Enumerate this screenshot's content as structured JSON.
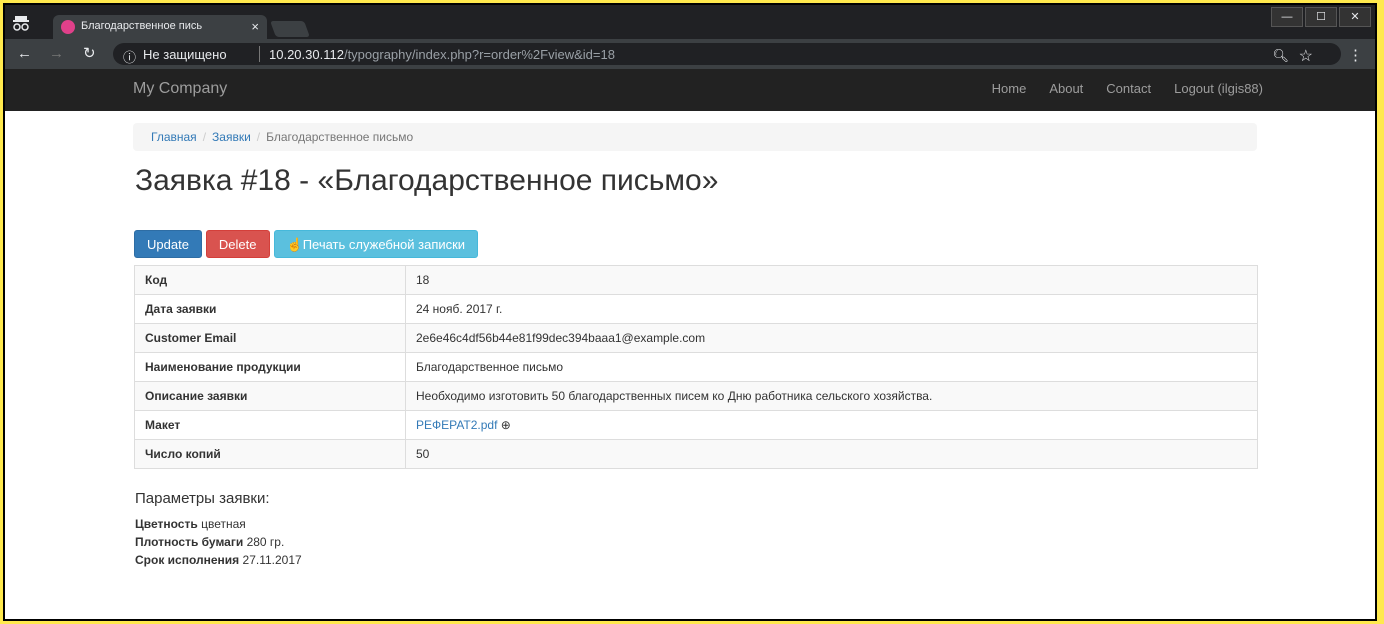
{
  "browser": {
    "tab": {
      "title": "Благодарственное пись"
    },
    "address": {
      "status": "Не защищено",
      "url_host": "10.20.30.112",
      "url_path": "/typography/index.php?r=order%2Fview&id=18"
    }
  },
  "site": {
    "brand": "My Company",
    "nav": [
      "Home",
      "About",
      "Contact",
      "Logout (ilgis88)"
    ]
  },
  "breadcrumb": {
    "items": [
      "Главная",
      "Заявки"
    ],
    "current": "Благодарственное письмо"
  },
  "page": {
    "title": "Заявка #18 - «Благодарственное письмо»",
    "buttons": {
      "update": "Update",
      "delete": "Delete",
      "print": "Печать служебной записки"
    }
  },
  "detail": {
    "rows": [
      {
        "label": "Код",
        "value": "18"
      },
      {
        "label": "Дата заявки",
        "value": "24 нояб. 2017 г."
      },
      {
        "label": "Customer Email",
        "value": "2e6e46c4df56b44e81f99dec394baaa1@example.com"
      },
      {
        "label": "Наименование продукции",
        "value": "Благодарственное письмо"
      },
      {
        "label": "Описание заявки",
        "value": "Необходимо изготовить 50 благодарственных писем ко Дню работника сельского хозяйства."
      },
      {
        "label": "Макет",
        "value": "РЕФЕРАТ2.pdf"
      },
      {
        "label": "Число копий",
        "value": "50"
      }
    ]
  },
  "params": {
    "heading": "Параметры заявки:",
    "items": [
      {
        "label": "Цветность",
        "value": "цветная"
      },
      {
        "label": "Плотность бумаги",
        "value": "280 гр."
      },
      {
        "label": "Срок исполнения",
        "value": "27.11.2017"
      }
    ]
  },
  "icons": {
    "incognito": "incognito-icon",
    "favicon": "favicon-icon",
    "info": "info-icon",
    "print": "hand-point-icon",
    "download": "download-circle-icon"
  },
  "colors": {
    "primary": "#337ab7",
    "danger": "#d9534f",
    "info": "#5bc0de",
    "navbar": "#222222"
  }
}
